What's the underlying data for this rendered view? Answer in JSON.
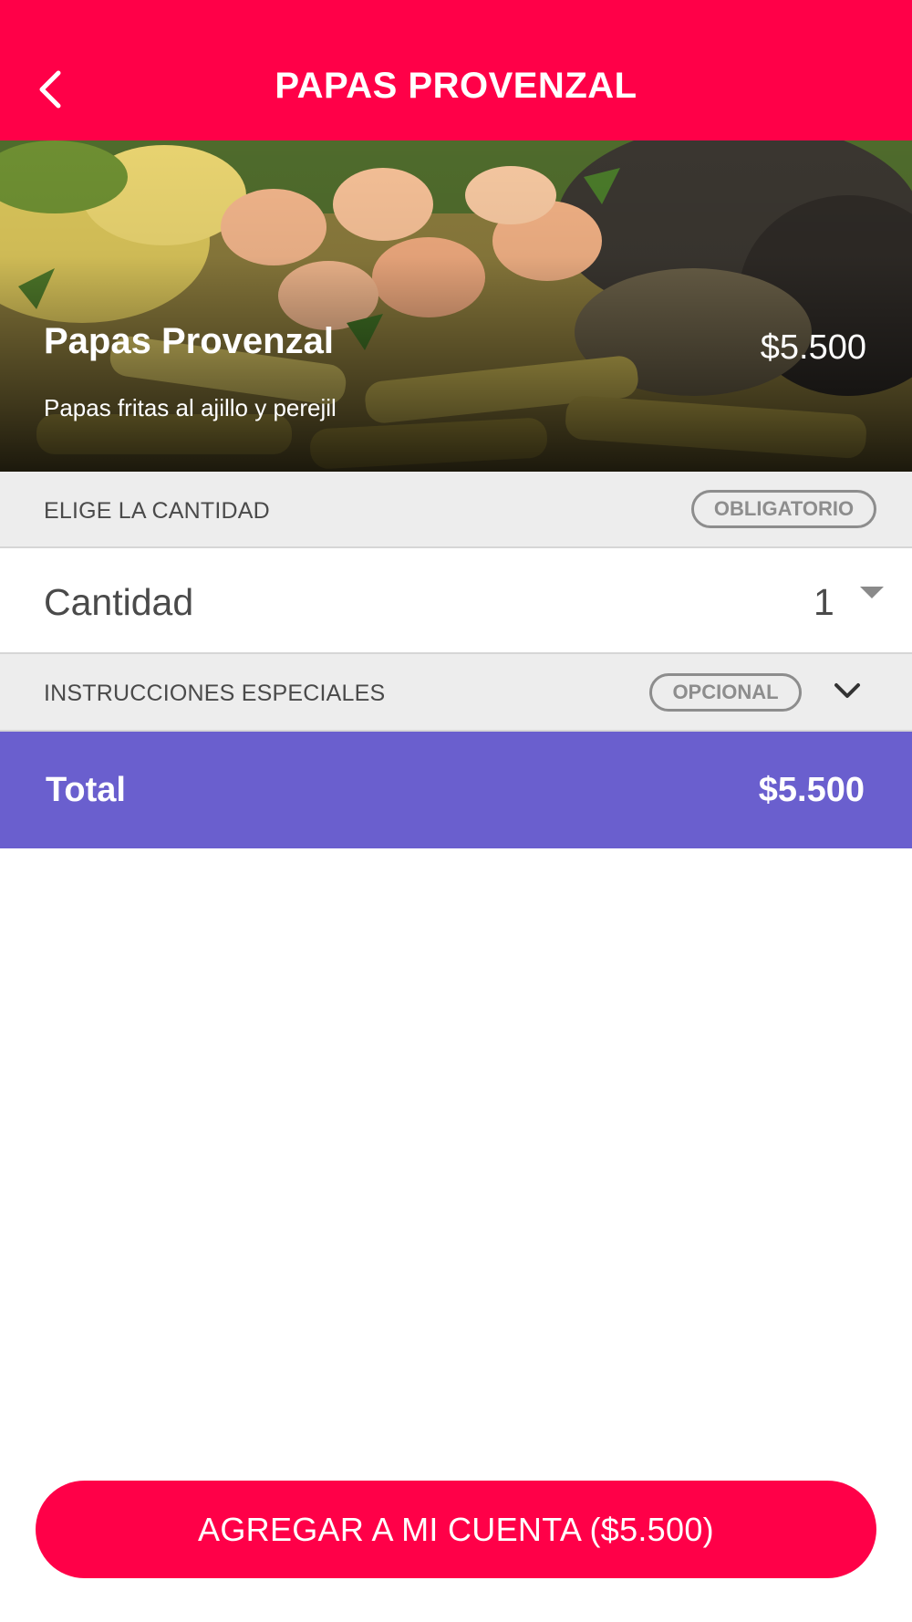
{
  "header": {
    "title": "PAPAS PROVENZAL",
    "back_icon": "chevron-left-icon"
  },
  "product": {
    "name": "Papas Provenzal",
    "price": "$5.500",
    "description": "Papas fritas al ajillo y perejil",
    "image": "food-photo"
  },
  "quantity_section": {
    "title": "ELIGE LA CANTIDAD",
    "badge": "OBLIGATORIO",
    "label": "Cantidad",
    "selected": "1",
    "dropdown_icon": "caret-down-icon"
  },
  "instructions_section": {
    "title": "INSTRUCCIONES ESPECIALES",
    "badge": "OPCIONAL",
    "expand_icon": "chevron-down-icon"
  },
  "total": {
    "label": "Total",
    "value": "$5.500"
  },
  "add_button": {
    "label": "AGREGAR A MI CUENTA ($5.500)"
  },
  "colors": {
    "brand": "#ff0048",
    "total_bar": "#6a5fce",
    "section_bg": "#ededed",
    "badge": "#8d8d8d"
  }
}
